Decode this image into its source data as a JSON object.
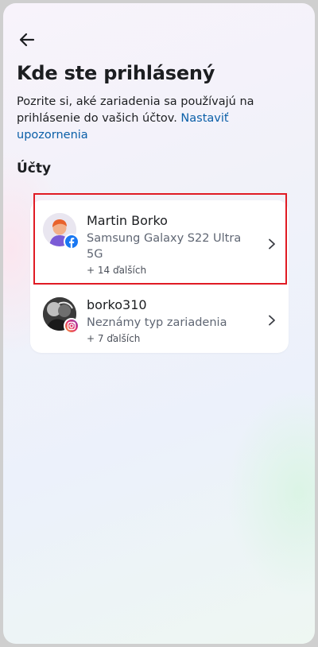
{
  "header": {
    "back_icon": "arrow-left-icon",
    "title": "Kde ste prihlásený",
    "description": "Pozrite si, aké zariadenia sa používajú na prihlásenie do vašich účtov.",
    "link": "Nastaviť upozornenia"
  },
  "section_title": "Účty",
  "accounts": [
    {
      "name": "Martin Borko",
      "device": "Samsung Galaxy S22 Ultra 5G",
      "more": "+ 14 ďalších",
      "platform_icon": "facebook-icon",
      "chevron_icon": "chevron-right-icon"
    },
    {
      "name": "borko310",
      "device": "Neznámy typ zariadenia",
      "more": "+ 7 ďalších",
      "platform_icon": "instagram-icon",
      "chevron_icon": "chevron-right-icon"
    }
  ],
  "colors": {
    "link": "#0a5fa8",
    "highlight": "#e01b24",
    "facebook": "#1877f2"
  }
}
